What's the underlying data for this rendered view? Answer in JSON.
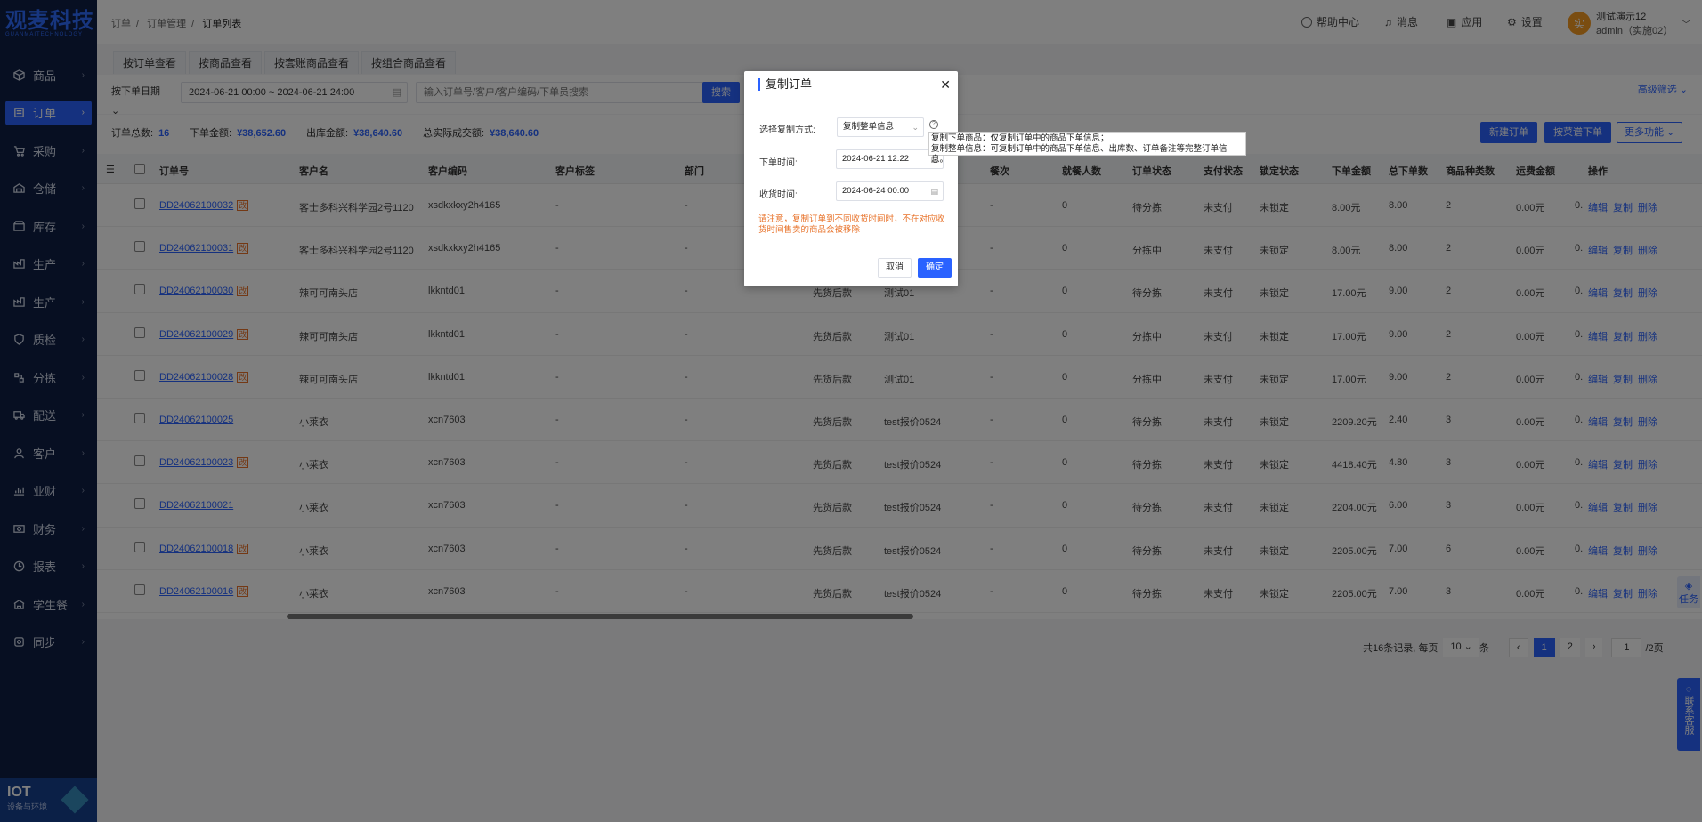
{
  "app": {
    "logo_cn": "观麦科技",
    "logo_en": "GUANMAITECHNOLOGY"
  },
  "sidebar": {
    "items": [
      {
        "label": "商品",
        "icon": "cube-icon"
      },
      {
        "label": "订单",
        "icon": "order-icon",
        "active": true
      },
      {
        "label": "采购",
        "icon": "cart-icon"
      },
      {
        "label": "仓储",
        "icon": "warehouse-icon"
      },
      {
        "label": "库存",
        "icon": "inventory-icon"
      },
      {
        "label": "生产",
        "icon": "factory-icon"
      },
      {
        "label": "生产",
        "icon": "factory-icon"
      },
      {
        "label": "质检",
        "icon": "shield-icon"
      },
      {
        "label": "分拣",
        "icon": "sort-icon"
      },
      {
        "label": "配送",
        "icon": "truck-icon"
      },
      {
        "label": "客户",
        "icon": "user-icon"
      },
      {
        "label": "业财",
        "icon": "finance-chart-icon"
      },
      {
        "label": "财务",
        "icon": "money-icon"
      },
      {
        "label": "报表",
        "icon": "report-icon"
      },
      {
        "label": "学生餐",
        "icon": "school-icon"
      },
      {
        "label": "同步",
        "icon": "sync-icon"
      }
    ],
    "iot_title": "IOT",
    "iot_sub": "设备与环境"
  },
  "header": {
    "breadcrumbs": [
      "订单",
      "订单管理",
      "订单列表"
    ],
    "help": "帮助中心",
    "messages": "消息",
    "apps": "应用",
    "settings": "设置",
    "user_name": "测试演示12",
    "user_sub": "admin（实施02）",
    "avatar_text": "实"
  },
  "tabs": [
    "按订单查看",
    "按商品查看",
    "按套账商品查看",
    "按组合商品查看"
  ],
  "filter": {
    "date_type": "按下单日期",
    "date_range": "2024-06-21 00:00 ~ 2024-06-21 24:00",
    "search_placeholder": "输入订单号/客户/客户编码/下单员搜索",
    "search_btn": "搜索",
    "advanced": "高级筛选"
  },
  "summary": {
    "count_label": "订单总数:",
    "count": "16",
    "order_amount_label": "下单金额:",
    "order_amount": "¥38,652.60",
    "out_amount_label": "出库金额:",
    "out_amount": "¥38,640.60",
    "actual_label": "总实际成交额:",
    "actual": "¥38,640.60",
    "new_btn": "新建订单",
    "bysheet_btn": "按菜谱下单",
    "more_btn": "更多功能"
  },
  "table": {
    "headers": {
      "order_no": "订单号",
      "customer": "客户名",
      "code": "客户编码",
      "tag": "客户标签",
      "dept": "部门",
      "times": "餐次",
      "diners": "就餐人数",
      "status": "订单状态",
      "pay": "支付状态",
      "lock": "锁定状态",
      "amount": "下单金额",
      "qty": "总下单数",
      "kinds": "商品种类数",
      "freight": "运费金额",
      "ops": "操作"
    },
    "rows": [
      {
        "order_no": "DD24062100032",
        "mod": true,
        "customer": "客士多科兴科学园2号1120",
        "code": "xsdkxkxy2h4165",
        "tag": "-",
        "dept": "-",
        "settle": "",
        "route": "",
        "times": "-",
        "diners": "0",
        "status": "待分拣",
        "pay": "未支付",
        "lock": "未锁定",
        "amount": "8.00元",
        "qty": "8.00",
        "kinds": "2",
        "freight": "0.00元",
        "extra": "0."
      },
      {
        "order_no": "DD24062100031",
        "mod": true,
        "customer": "客士多科兴科学园2号1120",
        "code": "xsdkxkxy2h4165",
        "tag": "-",
        "dept": "-",
        "settle": "",
        "route": "",
        "times": "-",
        "diners": "0",
        "status": "分拣中",
        "pay": "未支付",
        "lock": "未锁定",
        "amount": "8.00元",
        "qty": "8.00",
        "kinds": "2",
        "freight": "0.00元",
        "extra": "0."
      },
      {
        "order_no": "DD24062100030",
        "mod": true,
        "customer": "辣可可南头店",
        "code": "lkkntd01",
        "tag": "-",
        "dept": "-",
        "settle": "先货后款",
        "route": "测试01",
        "times": "-",
        "diners": "0",
        "status": "待分拣",
        "pay": "未支付",
        "lock": "未锁定",
        "amount": "17.00元",
        "qty": "9.00",
        "kinds": "2",
        "freight": "0.00元",
        "extra": "0."
      },
      {
        "order_no": "DD24062100029",
        "mod": true,
        "customer": "辣可可南头店",
        "code": "lkkntd01",
        "tag": "-",
        "dept": "-",
        "settle": "先货后款",
        "route": "测试01",
        "times": "-",
        "diners": "0",
        "status": "分拣中",
        "pay": "未支付",
        "lock": "未锁定",
        "amount": "17.00元",
        "qty": "9.00",
        "kinds": "2",
        "freight": "0.00元",
        "extra": "0."
      },
      {
        "order_no": "DD24062100028",
        "mod": true,
        "customer": "辣可可南头店",
        "code": "lkkntd01",
        "tag": "-",
        "dept": "-",
        "settle": "先货后款",
        "route": "测试01",
        "times": "-",
        "diners": "0",
        "status": "分拣中",
        "pay": "未支付",
        "lock": "未锁定",
        "amount": "17.00元",
        "qty": "9.00",
        "kinds": "2",
        "freight": "0.00元",
        "extra": "0."
      },
      {
        "order_no": "DD24062100025",
        "mod": false,
        "customer": "小莱衣",
        "code": "xcn7603",
        "tag": "-",
        "dept": "-",
        "settle": "先货后款",
        "route": "test报价0524",
        "times": "-",
        "diners": "0",
        "status": "待分拣",
        "pay": "未支付",
        "lock": "未锁定",
        "amount": "2209.20元",
        "qty": "2.40",
        "kinds": "3",
        "freight": "0.00元",
        "extra": "0."
      },
      {
        "order_no": "DD24062100023",
        "mod": true,
        "customer": "小莱衣",
        "code": "xcn7603",
        "tag": "-",
        "dept": "-",
        "settle": "先货后款",
        "route": "test报价0524",
        "times": "-",
        "diners": "0",
        "status": "待分拣",
        "pay": "未支付",
        "lock": "未锁定",
        "amount": "4418.40元",
        "qty": "4.80",
        "kinds": "3",
        "freight": "0.00元",
        "extra": "0."
      },
      {
        "order_no": "DD24062100021",
        "mod": false,
        "customer": "小莱衣",
        "code": "xcn7603",
        "tag": "-",
        "dept": "-",
        "settle": "先货后款",
        "route": "test报价0524",
        "times": "-",
        "diners": "0",
        "status": "待分拣",
        "pay": "未支付",
        "lock": "未锁定",
        "amount": "2204.00元",
        "qty": "6.00",
        "kinds": "3",
        "freight": "0.00元",
        "extra": "0."
      },
      {
        "order_no": "DD24062100018",
        "mod": true,
        "customer": "小莱衣",
        "code": "xcn7603",
        "tag": "-",
        "dept": "-",
        "settle": "先货后款",
        "route": "test报价0524",
        "times": "-",
        "diners": "0",
        "status": "待分拣",
        "pay": "未支付",
        "lock": "未锁定",
        "amount": "2205.00元",
        "qty": "7.00",
        "kinds": "6",
        "freight": "0.00元",
        "extra": "0."
      },
      {
        "order_no": "DD24062100016",
        "mod": true,
        "customer": "小莱衣",
        "code": "xcn7603",
        "tag": "-",
        "dept": "-",
        "settle": "先货后款",
        "route": "test报价0524",
        "times": "-",
        "diners": "0",
        "status": "待分拣",
        "pay": "未支付",
        "lock": "未锁定",
        "amount": "2205.00元",
        "qty": "7.00",
        "kinds": "3",
        "freight": "0.00元",
        "extra": "0."
      }
    ],
    "mod_tag": "改",
    "ops": [
      "编辑",
      "复制",
      "删除"
    ]
  },
  "pager": {
    "total_text": "共16条记录, 每页",
    "page_size": "10",
    "unit": "条",
    "prev": "‹",
    "pages": [
      "1",
      "2"
    ],
    "next": "›",
    "jump": "1",
    "total_pages": "/2页"
  },
  "float": {
    "task": "任务",
    "service": "联系客服"
  },
  "dialog": {
    "title": "复制订单",
    "method_label": "选择复制方式:",
    "method_value": "复制整单信息",
    "order_time_label": "下单时间:",
    "order_time": "2024-06-21 12:22",
    "receive_time_label": "收货时间:",
    "receive_time": "2024-06-24 00:00",
    "warning": "请注意，复制订单到不同收货时间时，不在对应收货时间售卖的商品会被移除",
    "cancel": "取消",
    "ok": "确定",
    "tooltip_line1": "复制下单商品：仅复制订单中的商品下单信息；",
    "tooltip_line2": "复制整单信息：可复制订单中的商品下单信息、出库数、订单备注等完整订单信息。"
  }
}
